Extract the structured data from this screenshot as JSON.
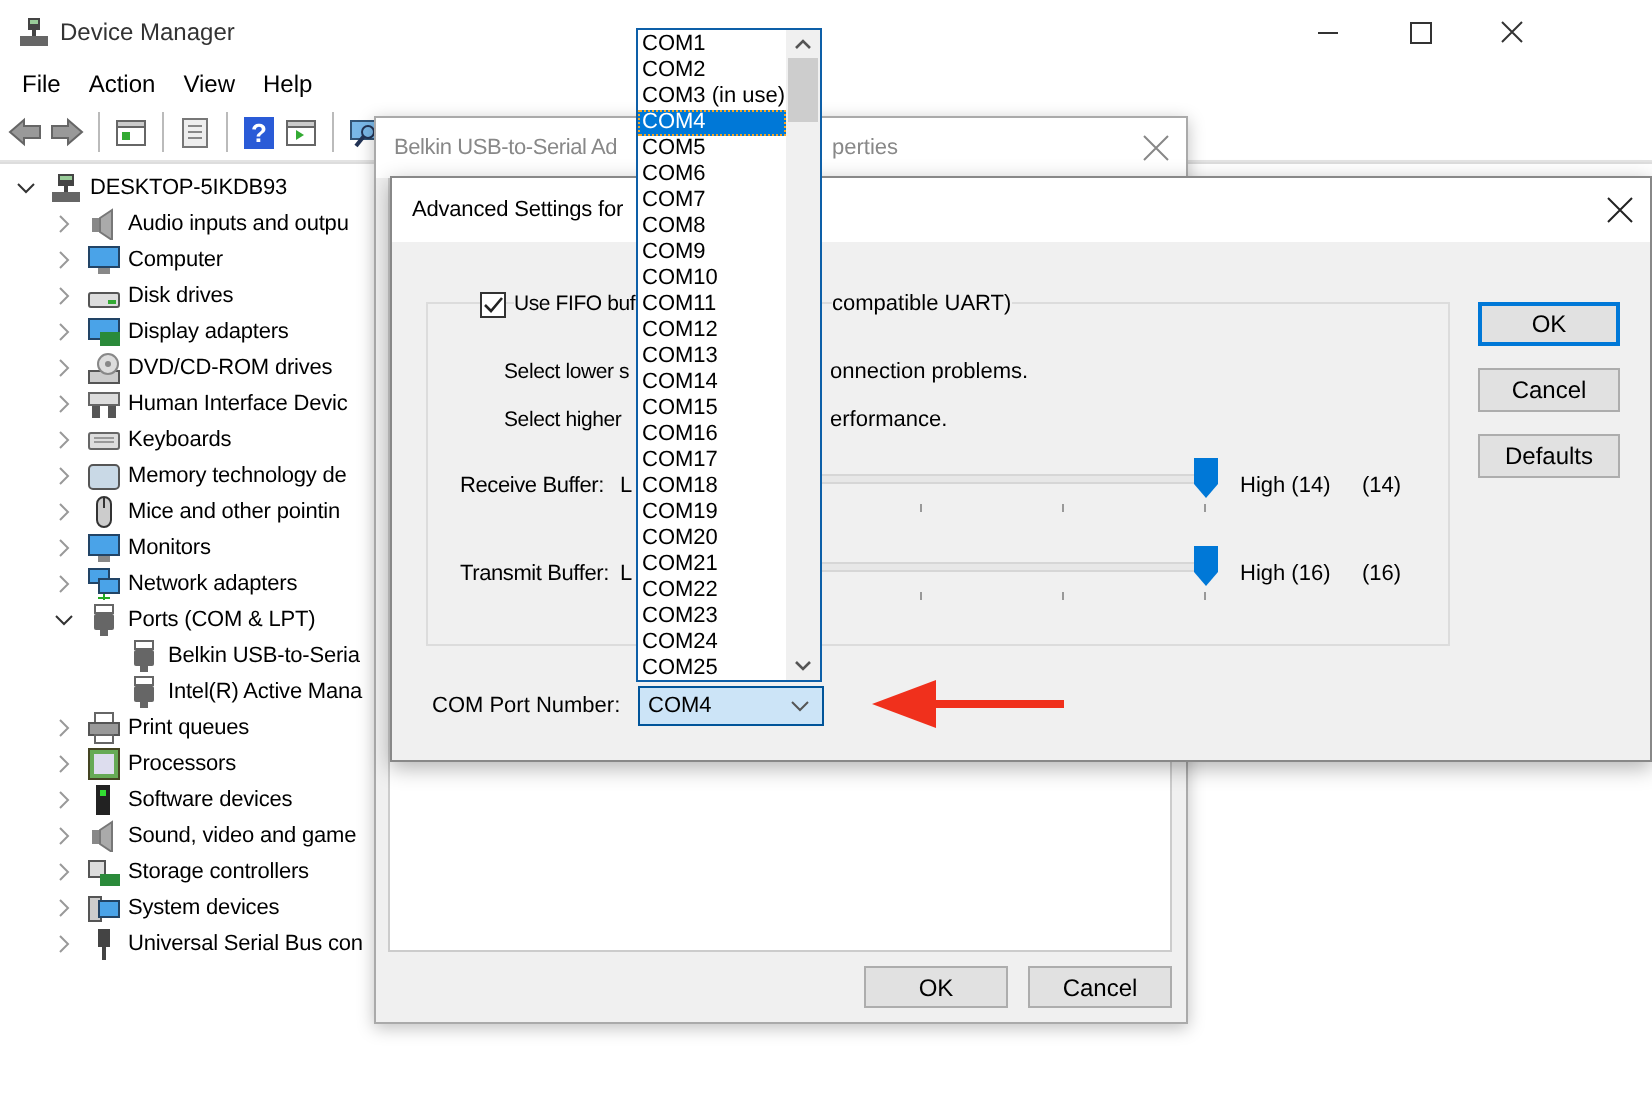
{
  "window": {
    "title": "Device Manager"
  },
  "menu": [
    "File",
    "Action",
    "View",
    "Help"
  ],
  "toolbar": {
    "help_icon_glyph": "?"
  },
  "tree": {
    "label": "DESKTOP-5IKDB93",
    "expanded": true,
    "children": [
      {
        "label": "Audio inputs and outpu",
        "expanded": false
      },
      {
        "label": "Computer",
        "expanded": false
      },
      {
        "label": "Disk drives",
        "expanded": false
      },
      {
        "label": "Display adapters",
        "expanded": false
      },
      {
        "label": "DVD/CD-ROM drives",
        "expanded": false
      },
      {
        "label": "Human Interface Devic",
        "expanded": false
      },
      {
        "label": "Keyboards",
        "expanded": false
      },
      {
        "label": "Memory technology de",
        "expanded": false
      },
      {
        "label": "Mice and other pointin",
        "expanded": false
      },
      {
        "label": "Monitors",
        "expanded": false
      },
      {
        "label": "Network adapters",
        "expanded": false
      },
      {
        "label": "Ports (COM & LPT)",
        "expanded": true,
        "children": [
          {
            "label": "Belkin USB-to-Seria"
          },
          {
            "label": "Intel(R) Active Mana"
          }
        ]
      },
      {
        "label": "Print queues",
        "expanded": false
      },
      {
        "label": "Processors",
        "expanded": false
      },
      {
        "label": "Software devices",
        "expanded": false
      },
      {
        "label": "Sound, video and game",
        "expanded": false
      },
      {
        "label": "Storage controllers",
        "expanded": false
      },
      {
        "label": "System devices",
        "expanded": false
      },
      {
        "label": "Universal Serial Bus con",
        "expanded": false
      }
    ]
  },
  "properties_dialog": {
    "title_start": "Belkin USB-to-Serial Ad",
    "title_end": "perties",
    "buttons": [
      "OK",
      "Cancel"
    ]
  },
  "advanced_dialog": {
    "title": "Advanced Settings for",
    "fifo": {
      "label_start": "Use FIFO buf",
      "label_end": "compatible UART)",
      "checked": true
    },
    "notes": [
      {
        "start": "Select lower s",
        "end": "onnection problems."
      },
      {
        "start": "Select higher",
        "end": "erformance."
      }
    ],
    "buffers": [
      {
        "label": "Receive Buffer:",
        "low": "L",
        "level": 1,
        "high": "High (14)",
        "reading": "(14)"
      },
      {
        "label": "Transmit Buffer:",
        "low": "L",
        "level": 1,
        "high": "High (16)",
        "reading": "(16)"
      }
    ],
    "com_port": {
      "label": "COM Port Number:",
      "value": "COM4",
      "open": true,
      "options": [
        {
          "label": "COM1",
          "selected": false
        },
        {
          "label": "COM2",
          "selected": false
        },
        {
          "label": "COM3 (in use)",
          "selected": false
        },
        {
          "label": "COM4",
          "selected": true
        },
        {
          "label": "COM5",
          "selected": false
        },
        {
          "label": "COM6",
          "selected": false
        },
        {
          "label": "COM7",
          "selected": false
        },
        {
          "label": "COM8",
          "selected": false
        },
        {
          "label": "COM9",
          "selected": false
        },
        {
          "label": "COM10",
          "selected": false
        },
        {
          "label": "COM11",
          "selected": false
        },
        {
          "label": "COM12",
          "selected": false
        },
        {
          "label": "COM13",
          "selected": false
        },
        {
          "label": "COM14",
          "selected": false
        },
        {
          "label": "COM15",
          "selected": false
        },
        {
          "label": "COM16",
          "selected": false
        },
        {
          "label": "COM17",
          "selected": false
        },
        {
          "label": "COM18",
          "selected": false
        },
        {
          "label": "COM19",
          "selected": false
        },
        {
          "label": "COM20",
          "selected": false
        },
        {
          "label": "COM21",
          "selected": false
        },
        {
          "label": "COM22",
          "selected": false
        },
        {
          "label": "COM23",
          "selected": false
        },
        {
          "label": "COM24",
          "selected": false
        },
        {
          "label": "COM25",
          "selected": false
        }
      ]
    },
    "buttons": [
      {
        "label": "OK",
        "default": true
      },
      {
        "label": "Cancel",
        "default": false
      },
      {
        "label": "Defaults",
        "default": false
      }
    ]
  }
}
